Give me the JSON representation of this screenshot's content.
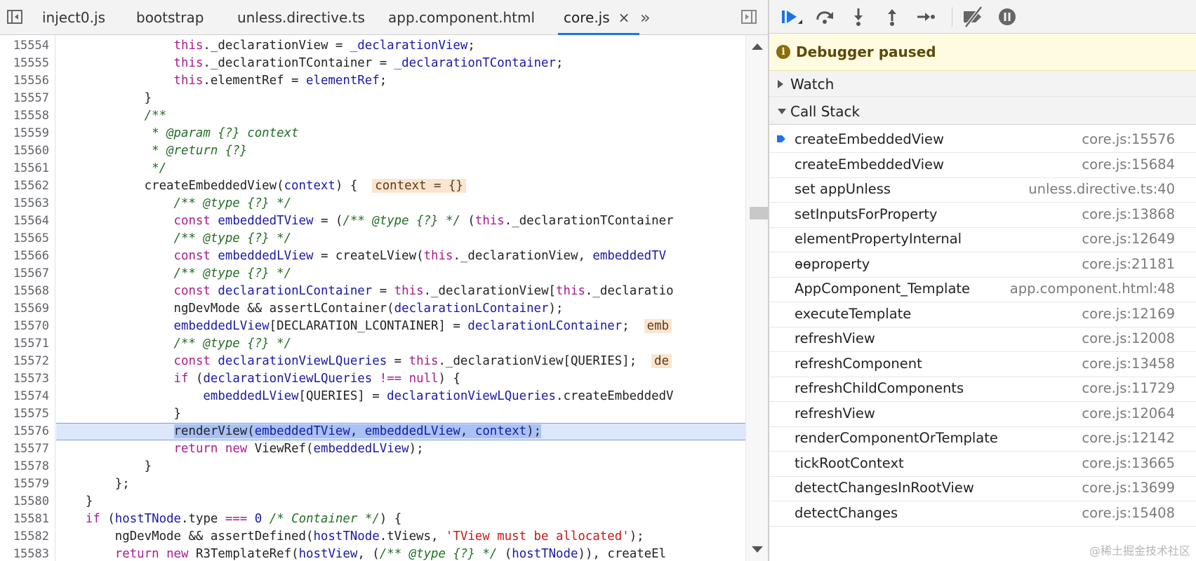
{
  "editor": {
    "tabs": [
      {
        "label": "inject0.js"
      },
      {
        "label": "bootstrap"
      },
      {
        "label": "unless.directive.ts"
      },
      {
        "label": "app.component.html"
      },
      {
        "label": "core.js",
        "active": true
      }
    ],
    "close_glyph": "×",
    "more_glyph": "»",
    "current_line": 15576,
    "lines": [
      {
        "n": "15554",
        "html": "                <span class=\"t-kw\">this</span>._declarationView = <span class=\"t-var\">_declarationView</span>;"
      },
      {
        "n": "15555",
        "html": "                <span class=\"t-kw\">this</span>._declarationTContainer = <span class=\"t-var\">_declarationTContainer</span>;"
      },
      {
        "n": "15556",
        "html": "                <span class=\"t-kw\">this</span>.elementRef = <span class=\"t-var\">elementRef</span>;"
      },
      {
        "n": "15557",
        "html": "            }"
      },
      {
        "n": "15558",
        "html": "            <span class=\"t-cm\">/**</span>"
      },
      {
        "n": "15559",
        "html": "<span class=\"t-cm\">             * @param {?} context</span>"
      },
      {
        "n": "15560",
        "html": "<span class=\"t-cm\">             * @return {?}</span>"
      },
      {
        "n": "15561",
        "html": "<span class=\"t-cm\">             */</span>"
      },
      {
        "n": "15562",
        "html": "            createEmbeddedView(<span class=\"t-var\">context</span>) {  <span class=\"t-pv\">context = {}</span>"
      },
      {
        "n": "15563",
        "html": "                <span class=\"t-cm\">/** @type {?} */</span>"
      },
      {
        "n": "15564",
        "html": "                <span class=\"t-kw\">const</span> <span class=\"t-var\">embeddedTView</span> = (<span class=\"t-cm\">/** @type {?} */</span> (<span class=\"t-kw\">this</span>._declarationTContainer"
      },
      {
        "n": "15565",
        "html": "                <span class=\"t-cm\">/** @type {?} */</span>"
      },
      {
        "n": "15566",
        "html": "                <span class=\"t-kw\">const</span> <span class=\"t-var\">embeddedLView</span> = createLView(<span class=\"t-kw\">this</span>._declarationView, <span class=\"t-var\">embeddedTV</span>"
      },
      {
        "n": "15567",
        "html": "                <span class=\"t-cm\">/** @type {?} */</span>"
      },
      {
        "n": "15568",
        "html": "                <span class=\"t-kw\">const</span> <span class=\"t-var\">declarationLContainer</span> = <span class=\"t-kw\">this</span>._declarationView[<span class=\"t-kw\">this</span>._declaratio"
      },
      {
        "n": "15569",
        "html": "                ngDevMode &amp;&amp; assertLContainer(<span class=\"t-var\">declarationLContainer</span>);"
      },
      {
        "n": "15570",
        "html": "                <span class=\"t-var\">embeddedLView</span>[DECLARATION_LCONTAINER] = <span class=\"t-var\">declarationLContainer</span>;  <span class=\"t-pv\">emb</span>"
      },
      {
        "n": "15571",
        "html": "                <span class=\"t-cm\">/** @type {?} */</span>"
      },
      {
        "n": "15572",
        "html": "                <span class=\"t-kw\">const</span> <span class=\"t-var\">declarationViewLQueries</span> = <span class=\"t-kw\">this</span>._declarationView[QUERIES];  <span class=\"t-pv\">de</span>"
      },
      {
        "n": "15573",
        "html": "                <span class=\"t-kw\">if</span> (<span class=\"t-var\">declarationViewLQueries</span> <span class=\"t-kw\">!==</span> <span class=\"t-kw\">null</span>) {"
      },
      {
        "n": "15574",
        "html": "                    <span class=\"t-var\">embeddedLView</span>[QUERIES] = <span class=\"t-var\">declarationViewLQueries</span>.createEmbeddedV"
      },
      {
        "n": "15575",
        "html": "                }"
      },
      {
        "n": "15576",
        "html": "                <span class=\"t-sel\">renderView(<span class=\"t-var\">embeddedTView</span>, <span class=\"t-var\">embeddedLView</span>, <span class=\"t-var\">context</span>);</span>"
      },
      {
        "n": "15577",
        "html": "                <span class=\"t-kw\">return</span> <span class=\"t-kw\">new</span> ViewRef(<span class=\"t-var\">embeddedLView</span>);"
      },
      {
        "n": "15578",
        "html": "            }"
      },
      {
        "n": "15579",
        "html": "        };"
      },
      {
        "n": "15580",
        "html": "    }"
      },
      {
        "n": "15581",
        "html": "    <span class=\"t-kw\">if</span> (<span class=\"t-var\">hostTNode</span>.type <span class=\"t-kw\">===</span> <span class=\"t-num\">0</span> <span class=\"t-cm\">/* Container */</span>) {"
      },
      {
        "n": "15582",
        "html": "        ngDevMode &amp;&amp; assertDefined(<span class=\"t-var\">hostTNode</span>.tViews, <span class=\"t-str\">'TView must be allocated'</span>);"
      },
      {
        "n": "15583",
        "html": "        <span class=\"t-kw\">return</span> <span class=\"t-kw\">new</span> R3TemplateRef(<span class=\"t-var\">hostView</span>, (<span class=\"t-cm\">/** @type {?} */</span> (<span class=\"t-var\">hostTNode</span>)), createEl"
      }
    ]
  },
  "debugger": {
    "paused_text": "Debugger paused",
    "info_glyph": "i",
    "watch_label": "Watch",
    "callstack_label": "Call Stack",
    "frames": [
      {
        "fn": "createEmbeddedView",
        "loc": "core.js:15576",
        "current": true
      },
      {
        "fn": "createEmbeddedView",
        "loc": "core.js:15684"
      },
      {
        "fn": "set appUnless",
        "loc": "unless.directive.ts:40"
      },
      {
        "fn": "setInputsForProperty",
        "loc": "core.js:13868"
      },
      {
        "fn": "elementPropertyInternal",
        "loc": "core.js:12649"
      },
      {
        "fn": "ɵɵproperty",
        "loc": "core.js:21181"
      },
      {
        "fn": "AppComponent_Template",
        "loc": "app.component.html:48"
      },
      {
        "fn": "executeTemplate",
        "loc": "core.js:12169"
      },
      {
        "fn": "refreshView",
        "loc": "core.js:12008"
      },
      {
        "fn": "refreshComponent",
        "loc": "core.js:13458"
      },
      {
        "fn": "refreshChildComponents",
        "loc": "core.js:11729"
      },
      {
        "fn": "refreshView",
        "loc": "core.js:12064"
      },
      {
        "fn": "renderComponentOrTemplate",
        "loc": "core.js:12142"
      },
      {
        "fn": "tickRootContext",
        "loc": "core.js:13665"
      },
      {
        "fn": "detectChangesInRootView",
        "loc": "core.js:13699"
      },
      {
        "fn": "detectChanges",
        "loc": "core.js:15408"
      }
    ]
  },
  "watermark": "@稀土掘金技术社区",
  "colors": {
    "accent": "#1a73e8",
    "paused_bg": "#fffbe0",
    "current_line_bg": "#dde7fb"
  },
  "icons": {
    "navigator": "sidebar-toggle-icon",
    "debugger_panel": "panel-toggle-icon",
    "resume": "resume-icon",
    "step_over": "step-over-icon",
    "step_into": "step-into-icon",
    "step_out": "step-out-icon",
    "step": "step-icon",
    "deactivate": "deactivate-breakpoints-icon",
    "pause_exceptions": "pause-on-exceptions-icon"
  }
}
